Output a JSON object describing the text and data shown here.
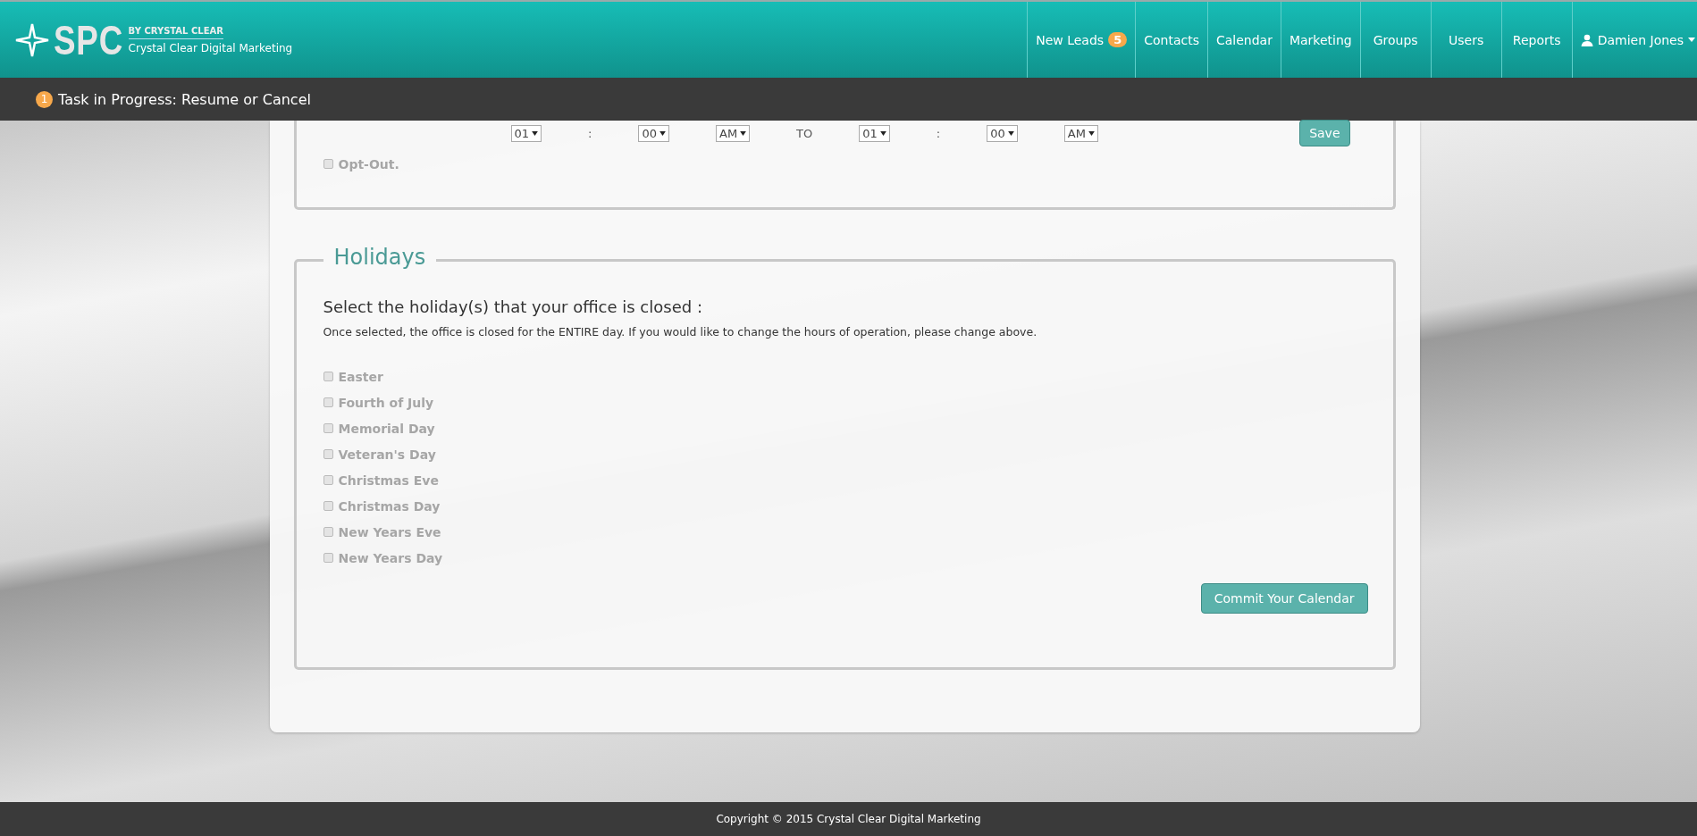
{
  "brand": {
    "logo": "SPC",
    "byline": "BY CRYSTAL CLEAR",
    "company": "Crystal Clear Digital Marketing"
  },
  "nav": [
    {
      "label": "New Leads",
      "badge": "5"
    },
    {
      "label": "Contacts"
    },
    {
      "label": "Calendar"
    },
    {
      "label": "Marketing"
    },
    {
      "label": "Groups"
    },
    {
      "label": "Users"
    },
    {
      "label": "Reports"
    },
    {
      "label": "Damien Jones",
      "kind": "user"
    }
  ],
  "task_bar": {
    "badge": "1",
    "text": "Task in Progress: Resume or Cancel"
  },
  "hours": {
    "row": [
      {
        "kind": "select",
        "value": "01"
      },
      {
        "kind": "text",
        "value": ":"
      },
      {
        "kind": "select",
        "value": "00"
      },
      {
        "kind": "select",
        "value": "AM"
      },
      {
        "kind": "text",
        "value": "TO"
      },
      {
        "kind": "select",
        "value": "01"
      },
      {
        "kind": "text",
        "value": ":"
      },
      {
        "kind": "select",
        "value": "00"
      },
      {
        "kind": "select",
        "value": "AM"
      }
    ],
    "save": "Save",
    "opt_out": {
      "label": "Opt-Out.",
      "checked": false,
      "disabled": true
    }
  },
  "holidays": {
    "legend": "Holidays",
    "heading": "Select the holiday(s) that your office is closed :",
    "note": "Once selected, the office is closed for the ENTIRE day. If you would like to change the hours of operation, please change above.",
    "items": [
      {
        "label": "Easter",
        "checked": false,
        "disabled": true
      },
      {
        "label": "Fourth of July",
        "checked": false,
        "disabled": true
      },
      {
        "label": "Memorial Day",
        "checked": false,
        "disabled": true
      },
      {
        "label": "Veteran's Day",
        "checked": false,
        "disabled": true
      },
      {
        "label": "Christmas Eve",
        "checked": false,
        "disabled": true
      },
      {
        "label": "Christmas Day",
        "checked": false,
        "disabled": true
      },
      {
        "label": "New Years Eve",
        "checked": false,
        "disabled": true
      },
      {
        "label": "New Years Day",
        "checked": false,
        "disabled": true
      }
    ],
    "commit": "Commit Your Calendar"
  },
  "footer": "Copyright © 2015 Crystal Clear Digital Marketing"
}
